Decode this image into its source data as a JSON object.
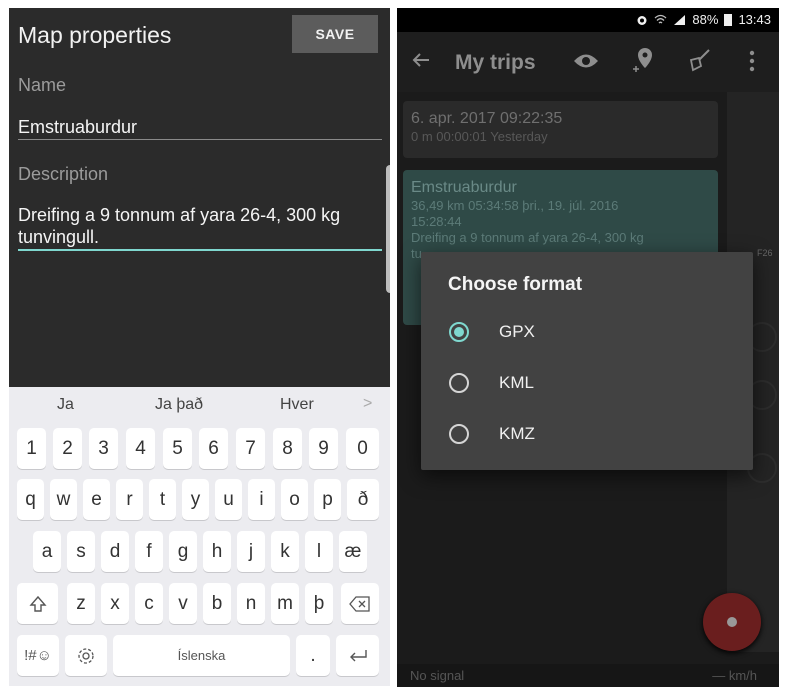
{
  "left": {
    "title": "Map properties",
    "save_label": "SAVE",
    "name_label": "Name",
    "name_value": "Emstruaburdur",
    "description_label": "Description",
    "description_line1": "Dreifing a 9 tonnum af yara 26-4, 300 kg",
    "description_line2": "tunvingull.",
    "accent_color": "#7fd8cf",
    "keyboard": {
      "suggestions": [
        "Ja",
        "Ja það",
        "Hver"
      ],
      "suggestion_more": ">",
      "row_numbers": [
        "1",
        "2",
        "3",
        "4",
        "5",
        "6",
        "7",
        "8",
        "9",
        "0"
      ],
      "row1": [
        "q",
        "w",
        "e",
        "r",
        "t",
        "y",
        "u",
        "i",
        "o",
        "p",
        "ð"
      ],
      "row2": [
        "a",
        "s",
        "d",
        "f",
        "g",
        "h",
        "j",
        "k",
        "l",
        "æ"
      ],
      "row3": [
        "z",
        "x",
        "c",
        "v",
        "b",
        "n",
        "m",
        "þ"
      ],
      "symbols_label": "!#☺",
      "space_label": "Íslenska",
      "period_label": "."
    }
  },
  "right": {
    "status": {
      "battery": "88%",
      "time": "13:43"
    },
    "toolbar_title": "My trips",
    "trips": [
      {
        "title": "6. apr. 2017 09:22:35",
        "sub1": "0 m  00:00:01  Yesterday"
      },
      {
        "title": "Emstruaburdur",
        "sub1": "36,49 km  05:34:58  þri., 19. júl. 2016",
        "sub2": "15:28:44",
        "sub3": "Dreifing a 9 tonnum af yara 26-4, 300 kg",
        "sub4": "tu"
      }
    ],
    "map_label": "F26",
    "dialog": {
      "title": "Choose format",
      "options": [
        "GPX",
        "KML",
        "KMZ"
      ],
      "selected": "GPX"
    },
    "bottom": {
      "no_signal": "No signal",
      "speed": "— km/h"
    },
    "fab_color": "#6a1e1e"
  }
}
